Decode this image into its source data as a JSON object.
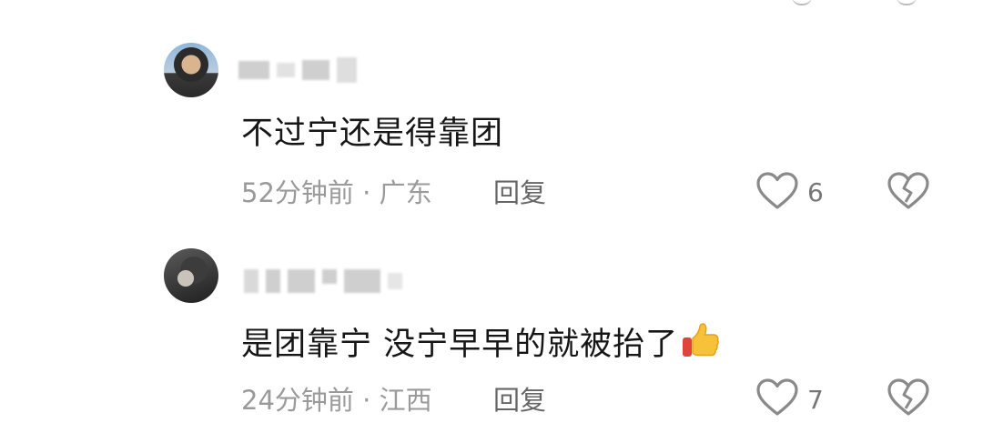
{
  "comments": [
    {
      "text": "不过宁还是得靠团",
      "time": "52分钟前",
      "sep": " · ",
      "location": "广东",
      "reply_label": "回复",
      "likes": "6"
    },
    {
      "text": "是团靠宁 没宁早早的就被抬了",
      "emoji": "thumbs-up-icon",
      "time": "24分钟前",
      "sep": " · ",
      "location": "江西",
      "reply_label": "回复",
      "likes": "7"
    }
  ],
  "colors": {
    "text": "#161616",
    "meta": "#9a9a9a",
    "reply": "#666666",
    "icon": "#8a8a8a"
  }
}
